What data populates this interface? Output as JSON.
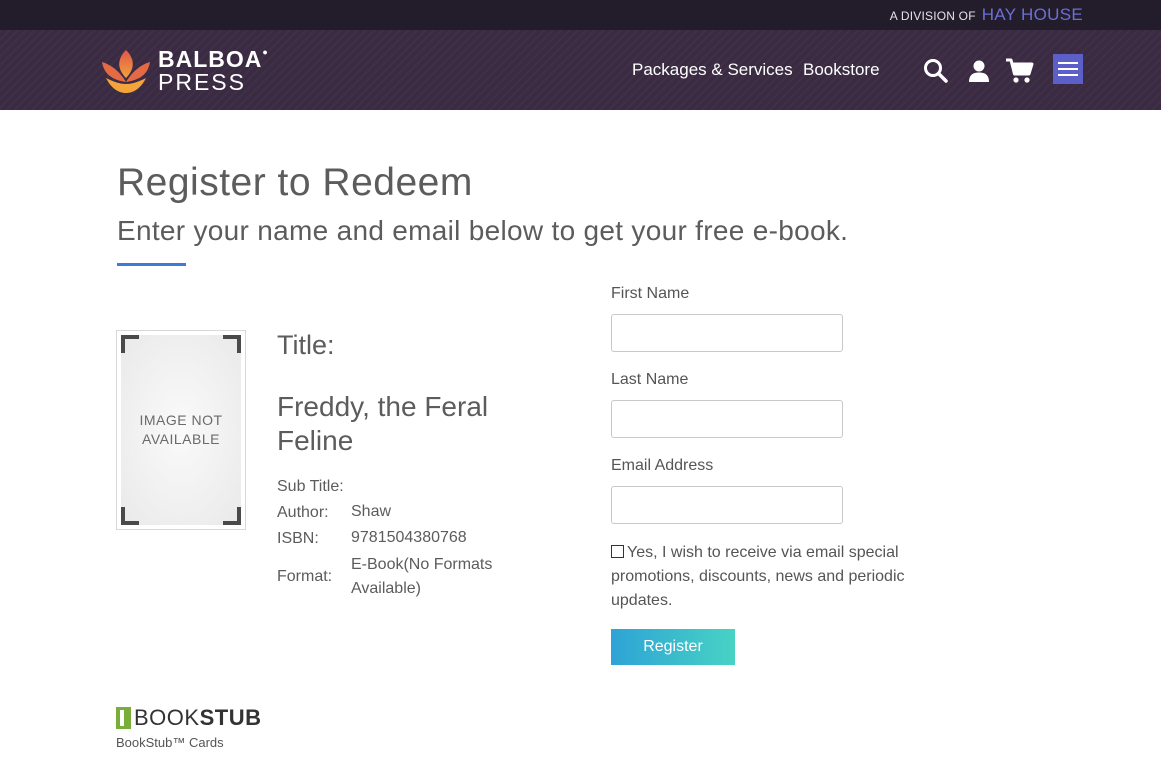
{
  "top_strip": {
    "division_prefix": "A DIVISION OF",
    "division_brand": "HAY HOUSE"
  },
  "header": {
    "logo_line1": "BALBOA",
    "logo_line2": "PRESS",
    "nav": [
      {
        "label": "Packages & Services"
      },
      {
        "label": "Bookstore"
      }
    ],
    "icons": [
      "search-icon",
      "user-icon",
      "cart-icon",
      "hamburger-menu-icon"
    ]
  },
  "main": {
    "heading": "Register to Redeem",
    "subheading": "Enter your name and email below to get your free e-book."
  },
  "book": {
    "cover_placeholder_line1": "IMAGE NOT",
    "cover_placeholder_line2": "AVAILABLE",
    "title_label": "Title:",
    "title": "Freddy, the Feral Feline",
    "subtitle_label": "Sub Title:",
    "subtitle": "",
    "author_label": "Author:",
    "author": "Shaw",
    "isbn_label": "ISBN:",
    "isbn": "9781504380768",
    "format_label": "Format:",
    "format_line1": "E-Book(No Formats",
    "format_line2": "Available)"
  },
  "form": {
    "first_name_label": "First Name",
    "first_name_value": "",
    "last_name_label": "Last Name",
    "last_name_value": "",
    "email_label": "Email Address",
    "email_value": "",
    "consent_checked": false,
    "consent_text": "Yes, I wish to receive via email special promotions, discounts, news and periodic updates.",
    "register_label": "Register"
  },
  "footer": {
    "logo_text_light": "BOOK",
    "logo_text_bold": "STUB",
    "caption": "BookStub™ Cards"
  },
  "colors": {
    "top_strip": "#231c2b",
    "header": "#3a2b43",
    "hay_house": "#6b6fd6",
    "menu_button": "#5b5fc7",
    "divider": "#3f7bd2",
    "register_gradient_start": "#2ea3d6",
    "register_gradient_end": "#47d3c4",
    "bookstub_green": "#7aae3b"
  }
}
